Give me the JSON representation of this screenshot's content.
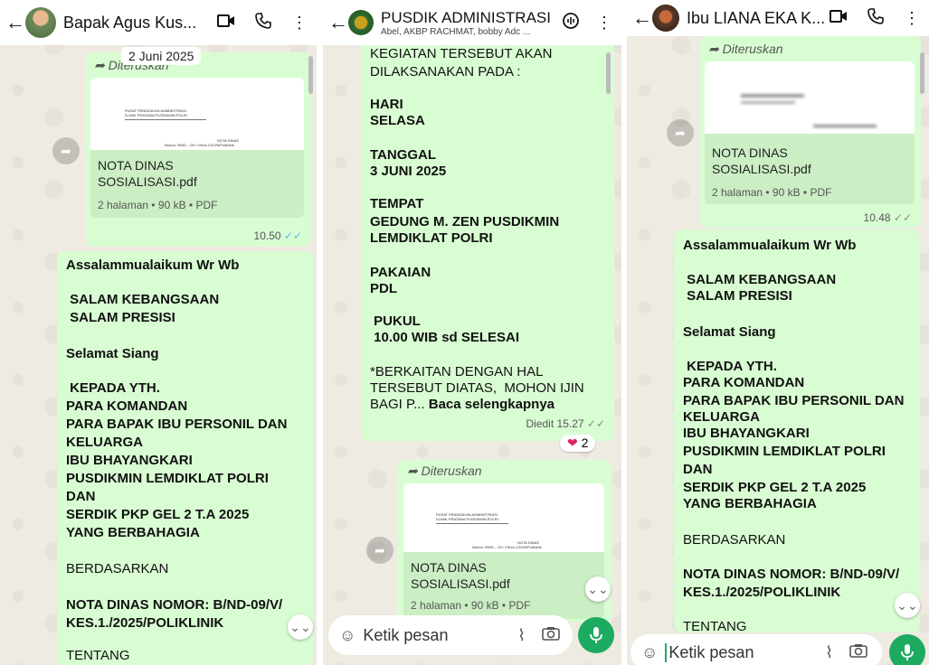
{
  "panels": [
    {
      "header": {
        "back": "←",
        "title": "Bapak Agus Kus...",
        "video_icon": "▢◂",
        "call_icon": "✆",
        "menu_icon": "⋮"
      },
      "date_chip": "2 Juni 2025",
      "forward_label": "Diteruskan",
      "doc": {
        "preview_line1": "PUSAT PENDIDIKAN ADMINISTRASI",
        "preview_line2": "KLINIK PRATAMA PUSDIKMIN POLRI",
        "preview_line3": "NOTA DINAS",
        "preview_line4": "Nomor: B/ND – 09 / V/Kes.1/2025/Poliklinik",
        "name": "NOTA DINAS SOSIALISASI.pdf",
        "meta": "2 halaman • 90 kB • PDF"
      },
      "time": "10.50",
      "message": {
        "l1": "Assalammualaikum Wr Wb",
        "l2": " SALAM KEBANGSAAN",
        "l3": " SALAM PRESISI",
        "l4": "Selamat Siang",
        "l5": " KEPADA YTH.",
        "l6": "PARA KOMANDAN",
        "l7": "PARA BAPAK IBU PERSONIL DAN",
        "l8": "KELUARGA",
        "l9": "IBU BHAYANGKARI",
        "l10": "PUSDIKMIN LEMDIKLAT POLRI",
        "l11": "DAN",
        "l12": "SERDIK PKP GEL 2 T.A 2025",
        "l13": "YANG BERBAHAGIA",
        "l14": "BERDASARKAN",
        "l15": "NOTA DINAS NOMOR: B/ND-09/V/",
        "l16": "KES.1./2025/POLIKLINIK",
        "l17": "TENTANG"
      }
    },
    {
      "header": {
        "back": "←",
        "title": "PUSDIK ADMINISTRASI",
        "subtitle": "Abel, AKBP RACHMAT, bobby Adc ...",
        "call_icon": "☏",
        "menu_icon": "⋮"
      },
      "message": {
        "l1": "KEGIATAN TERSEBUT AKAN",
        "l2": "DILAKSANAKAN PADA :",
        "l3": "HARI",
        "l4": "SELASA",
        "l5": "TANGGAL",
        "l6": "3 JUNI 2025",
        "l7": "TEMPAT",
        "l8": "GEDUNG M. ZEN PUSDIKMIN",
        "l9": "LEMDIKLAT POLRI",
        "l10": "PAKAIAN",
        "l11": "PDL",
        "l12": " PUKUL",
        "l13": " 10.00 WIB sd SELESAI",
        "l14": "*BERKAITAN DENGAN HAL",
        "l15": "TERSEBUT DIATAS,  MOHON IJIN",
        "l16": "BAGI P...",
        "read_more": " Baca selengkapnya"
      },
      "edited_time": "Diedit 15.27",
      "reaction_count": "2",
      "forward_label": "Diteruskan",
      "doc": {
        "preview_line1": "PUSAT PENDIDIKAN ADMINISTRASI",
        "preview_line2": "KLINIK PRATAMA PUSDIKMIN POLRI",
        "preview_line3": "NOTA DINAS",
        "preview_line4": "Nomor: B/ND – 09 / V/Kes.1/2025/Poliklinik",
        "name": "NOTA DINAS SOSIALISASI.pdf",
        "meta": "2 halaman • 90 kB • PDF"
      },
      "input_placeholder": "Ketik pesan"
    },
    {
      "header": {
        "back": "←",
        "title": "Ibu LIANA EKA K...",
        "video_icon": "▢◂",
        "call_icon": "✆",
        "menu_icon": "⋮"
      },
      "forward_label": "Diteruskan",
      "doc": {
        "name": "NOTA DINAS SOSIALISASI.pdf",
        "meta": "2 halaman • 90 kB • PDF"
      },
      "time": "10.48",
      "message": {
        "l1": "Assalammualaikum Wr Wb",
        "l2": " SALAM KEBANGSAAN",
        "l3": " SALAM PRESISI",
        "l4": "Selamat Siang",
        "l5": " KEPADA YTH.",
        "l6": "PARA KOMANDAN",
        "l7": "PARA BAPAK IBU PERSONIL DAN",
        "l8": "KELUARGA",
        "l9": "IBU BHAYANGKARI",
        "l10": "PUSDIKMIN LEMDIKLAT POLRI",
        "l11": "DAN",
        "l12": "SERDIK PKP GEL 2 T.A 2025",
        "l13": "YANG BERBAHAGIA",
        "l14": "BERDASARKAN",
        "l15": "NOTA DINAS NOMOR: B/ND-09/V/",
        "l16": "KES.1./2025/POLIKLINIK",
        "l17": "TENTANG"
      },
      "input_placeholder": "Ketik pesan"
    }
  ],
  "colors": {
    "bubble": "#d9fdd3",
    "accent": "#1daa61",
    "tick": "#53bdeb"
  }
}
